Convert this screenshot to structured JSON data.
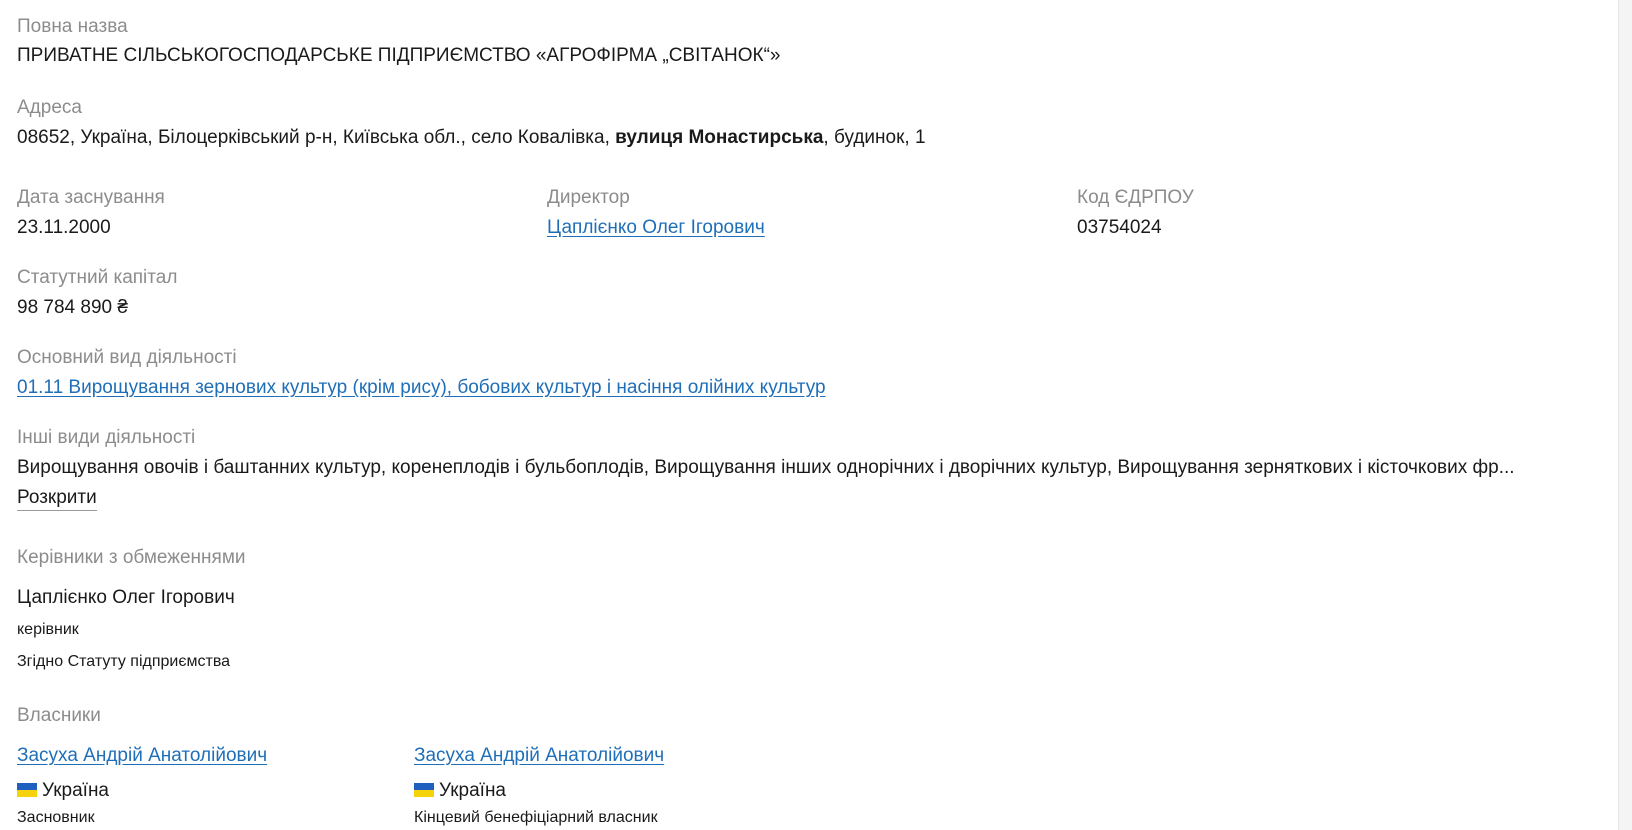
{
  "full_name": {
    "label": "Повна назва",
    "value": "ПРИВАТНЕ СІЛЬСЬКОГОСПОДАРСЬКЕ ПІДПРИЄМСТВО «АГРОФІРМА „СВІТАНОК“»"
  },
  "address": {
    "label": "Адреса",
    "prefix": "08652, Україна, Білоцерківський р-н, Київська обл., село Ковалівка, ",
    "street": "вулиця Монастирська",
    "suffix": ", будинок, 1"
  },
  "founded": {
    "label": "Дата заснування",
    "value": "23.11.2000"
  },
  "director": {
    "label": "Директор",
    "value": "Цаплієнко Олег Ігорович"
  },
  "edrpou": {
    "label": "Код ЄДРПОУ",
    "value": "03754024"
  },
  "capital": {
    "label": "Статутний капітал",
    "value": "98 784 890 ₴"
  },
  "main_activity": {
    "label": "Основний вид діяльності",
    "value": "01.11 Вирощування зернових культур (крім рису), бобових культур і насіння олійних культур"
  },
  "other_activities": {
    "label": "Інші види діяльності",
    "value": "Вирощування овочів і баштанних культур, коренеплодів і бульбоплодів, Вирощування інших однорічних і дворічних культур, Вирощування зерняткових і кісточкових фр...",
    "expand_label": "Розкрити"
  },
  "managers": {
    "label": "Керівники з обмеженнями",
    "items": [
      {
        "name": "Цаплієнко Олег Ігорович",
        "role": "керівник",
        "note": "Згідно Статуту підприємства"
      }
    ]
  },
  "owners": {
    "label": "Власники",
    "items": [
      {
        "name": "Засуха Андрій Анатолійович",
        "country": "Україна",
        "role": "Засновник"
      },
      {
        "name": "Засуха Андрій Анатолійович",
        "country": "Україна",
        "role": "Кінцевий бенефіціарний власник"
      }
    ]
  },
  "colors": {
    "link": "#1f6fb8",
    "label": "#8c8c8c",
    "text": "#1a1a1a",
    "flag_blue": "#1f5fbf",
    "flag_yellow": "#f5d20a"
  }
}
